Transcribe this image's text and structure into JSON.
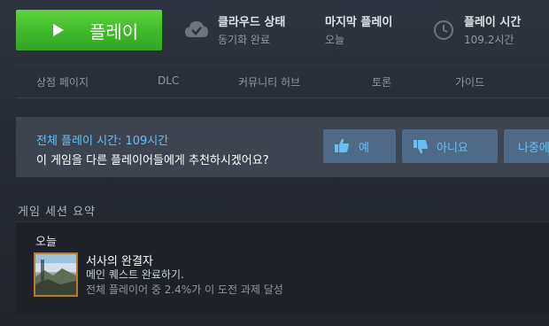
{
  "play_button": {
    "label": "플레이",
    "icon": "play-icon",
    "color": "#47bf2f"
  },
  "stats": {
    "cloud": {
      "title": "클라우드 상태",
      "value": "동기화 완료",
      "icon": "cloud-check-icon"
    },
    "last_played": {
      "title": "마지막 플레이",
      "value": "오늘"
    },
    "playtime": {
      "title": "플레이 시간",
      "value": "109.2시간",
      "icon": "clock-icon"
    }
  },
  "nav": {
    "items": [
      {
        "label": "상점 페이지"
      },
      {
        "label": "DLC"
      },
      {
        "label": "커뮤니티 허브"
      },
      {
        "label": "토론"
      },
      {
        "label": "가이드"
      }
    ]
  },
  "recommendation": {
    "hours_text": "전체 플레이 시간: 109시간",
    "question": "이 게임을 다른 플레이어들에게 추천하시겠어요?",
    "yes_label": "예",
    "no_label": "아니요",
    "later_label": "나중에",
    "accent_color": "#66c0f4"
  },
  "session_summary": {
    "title": "게임 세션 요약",
    "day": "오늘",
    "achievement": {
      "name": "서사의 완결자",
      "description": "메인 퀘스트 완료하기.",
      "rarity_text": "전체 플레이어 중 2.4%가 이 도전 과제 달성"
    }
  }
}
